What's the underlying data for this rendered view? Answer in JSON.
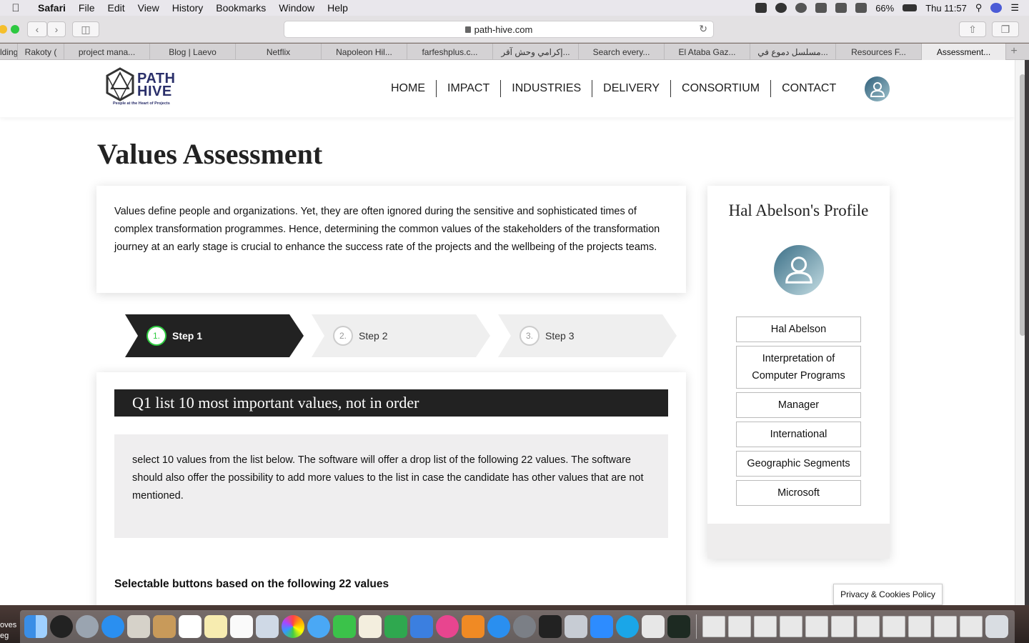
{
  "menubar": {
    "app": "Safari",
    "items": [
      "File",
      "Edit",
      "View",
      "History",
      "Bookmarks",
      "Window",
      "Help"
    ],
    "battery": "66%",
    "clock": "Thu 11:57"
  },
  "browser": {
    "url": "path-hive.com",
    "tabs": [
      "lding",
      "Rakoty (",
      "project mana...",
      "Blog | Laevo",
      "Netflix",
      "Napoleon Hil...",
      "farfeshplus.c...",
      "إكرامي وحش آقر...",
      "Search every...",
      "El Ataba Gaz...",
      "مسلسل دموع في...",
      "Resources F...",
      "Assessment..."
    ],
    "active_tab": 12
  },
  "site": {
    "logo_line1": "PATH",
    "logo_line2": "HIVE",
    "logo_tagline": "People at the Heart of Projects",
    "nav": [
      "HOME",
      "IMPACT",
      "INDUSTRIES",
      "DELIVERY",
      "CONSORTIUM",
      "CONTACT"
    ]
  },
  "page": {
    "title": "Values Assessment",
    "intro": "Values define people and organizations. Yet, they are often ignored during the sensitive and sophisticated times of complex transformation programmes. Hence, determining the common values of the stakeholders of the transformation journey at an early stage is crucial to enhance the success rate of the projects and the wellbeing of the projects teams.",
    "steps": [
      {
        "num": "1.",
        "label": "Step 1",
        "active": true
      },
      {
        "num": "2.",
        "label": "Step 2",
        "active": false
      },
      {
        "num": "3.",
        "label": "Step 3",
        "active": false
      }
    ],
    "question_title": "Q1 list 10 most important values, not in order",
    "question_body": "select 10 values from the list below. The software will offer a drop list of the following 22 values. The software should also offer the possibility to add more values to the list in case the candidate has other values that are not mentioned.",
    "selectable_heading": "Selectable buttons based on the following 22 values"
  },
  "profile": {
    "title": "Hal Abelson's Profile",
    "fields": [
      "Hal Abelson",
      "Interpretation of Computer Programs",
      "Manager",
      "International",
      "Geographic Segments",
      "Microsoft"
    ]
  },
  "privacy_label": "Privacy & Cookies Policy",
  "desktop_text": [
    "oves",
    "eg"
  ],
  "colors": {
    "accent_green": "#2ecc40",
    "dark": "#222222",
    "brand_navy": "#2a2f6a"
  }
}
